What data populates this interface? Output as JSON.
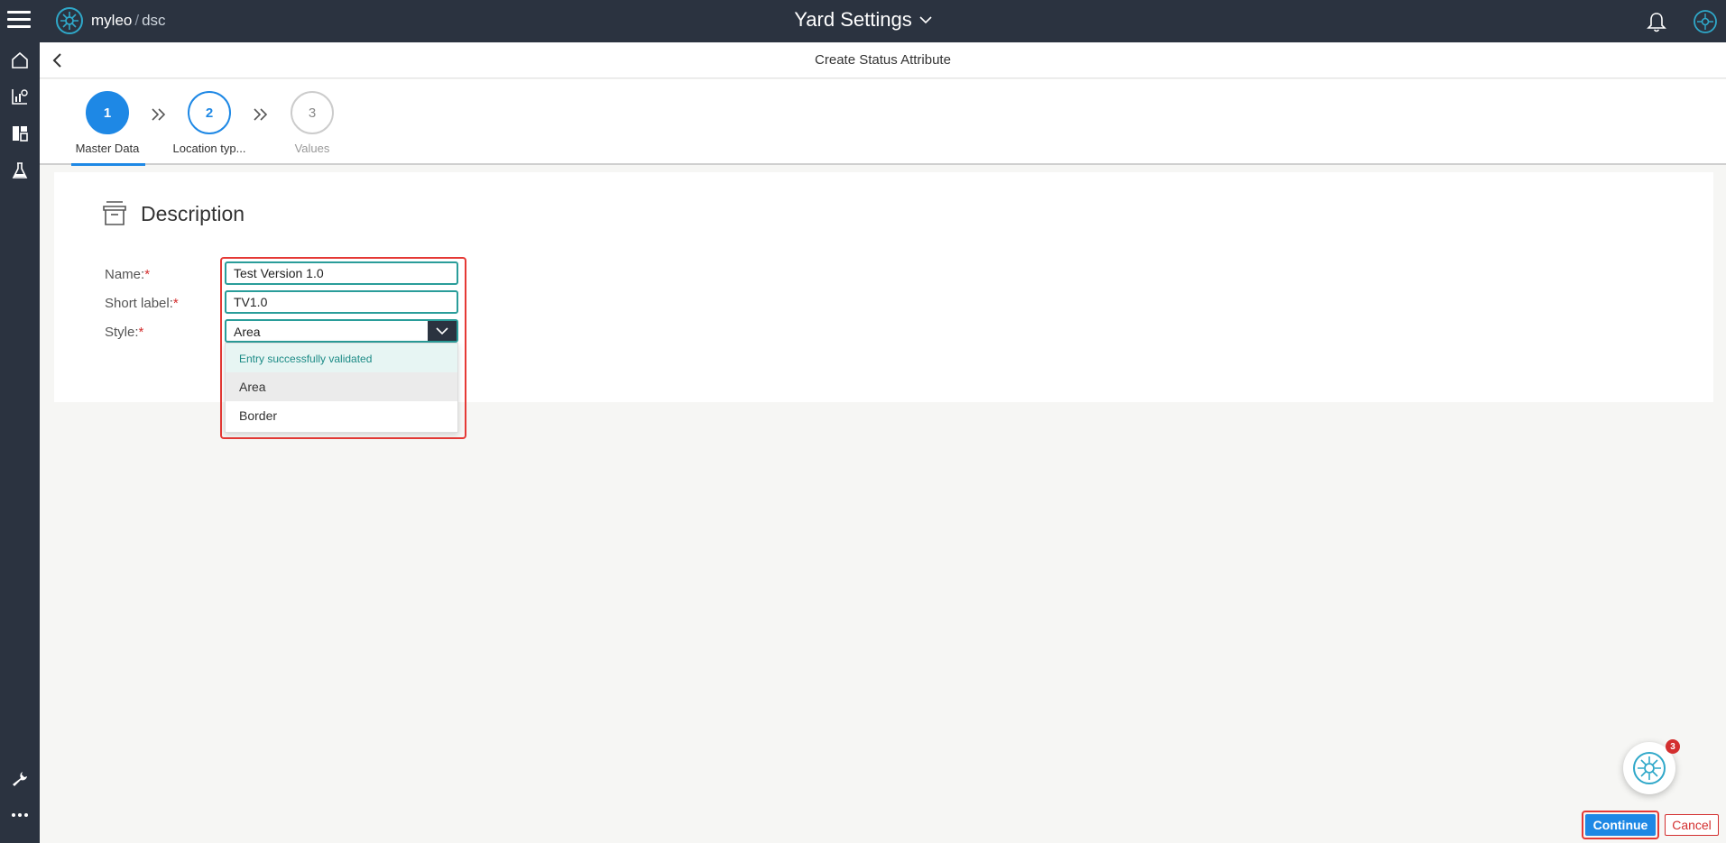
{
  "topbar": {
    "brand": "myleo",
    "brand_sep": "/",
    "brand_suffix": "dsc",
    "app_title": "Yard Settings"
  },
  "sidebar": {
    "items": [
      {
        "icon": "home-icon"
      },
      {
        "icon": "analytics-icon"
      },
      {
        "icon": "dashboard-icon"
      },
      {
        "icon": "lab-flask-icon"
      },
      {
        "icon": "wrench-icon"
      },
      {
        "icon": "more-dots-icon"
      }
    ]
  },
  "subheader": {
    "title": "Create Status Attribute"
  },
  "stepper": {
    "steps": [
      {
        "number": "1",
        "label": "Master Data",
        "state": "active"
      },
      {
        "number": "2",
        "label": "Location typ...",
        "state": "upcoming"
      },
      {
        "number": "3",
        "label": "Values",
        "state": "disabled"
      }
    ]
  },
  "section": {
    "title": "Description"
  },
  "form": {
    "name_label": "Name:",
    "name_value": "Test Version 1.0",
    "short_label_label": "Short label:",
    "short_label_value": "TV1.0",
    "style_label": "Style:",
    "style_value": "Area",
    "required_mark": "*"
  },
  "dropdown": {
    "validation_message": "Entry successfully validated",
    "options": [
      "Area",
      "Border"
    ],
    "selected": "Area"
  },
  "assistant": {
    "badge_count": "3"
  },
  "footer": {
    "continue_label": "Continue",
    "cancel_label": "Cancel"
  },
  "colors": {
    "topbar_bg": "#2b3340",
    "accent_blue": "#1e88e5",
    "validation_teal": "#2a9d9a",
    "highlight_red": "#e53935"
  }
}
